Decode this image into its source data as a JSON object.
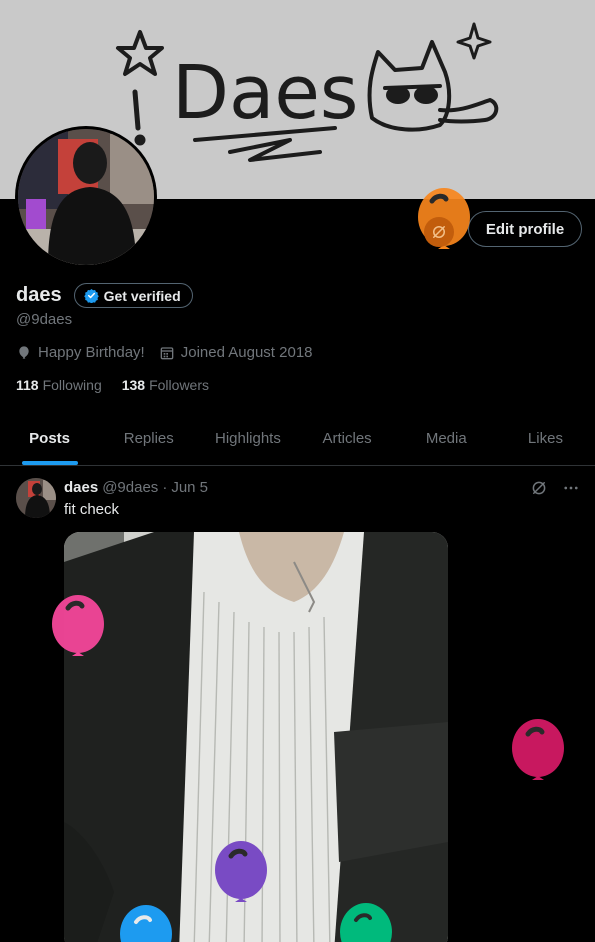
{
  "banner": {
    "sketch_text": "Daes",
    "paper_color": "#c9c9c9",
    "ink_color": "#1c1c1c"
  },
  "profile": {
    "display_name": "daes",
    "handle": "@9daes",
    "get_verified_label": "Get verified",
    "edit_profile_label": "Edit profile",
    "birthday_text": "Happy Birthday!",
    "joined_text": "Joined August 2018",
    "following_count": "118",
    "following_label": "Following",
    "followers_count": "138",
    "followers_label": "Followers"
  },
  "tabs": [
    {
      "label": "Posts",
      "active": true
    },
    {
      "label": "Replies",
      "active": false
    },
    {
      "label": "Highlights",
      "active": false
    },
    {
      "label": "Articles",
      "active": false
    },
    {
      "label": "Media",
      "active": false
    },
    {
      "label": "Likes",
      "active": false
    }
  ],
  "tweet": {
    "name": "daes",
    "handle": "@9daes",
    "separator": "·",
    "date": "Jun 5",
    "text": "fit check"
  },
  "balloons": [
    {
      "name": "orange-balloon",
      "color": "#f7861c"
    },
    {
      "name": "pink-balloon",
      "color": "#f4479a"
    },
    {
      "name": "magenta-balloon",
      "color": "#c8185f"
    },
    {
      "name": "purple-balloon",
      "color": "#794bc4"
    },
    {
      "name": "blue-balloon",
      "color": "#1d9bf0"
    },
    {
      "name": "green-balloon",
      "color": "#00ba7c"
    }
  ],
  "colors": {
    "accent": "#1d9bf0",
    "text_primary": "#e7e9ea",
    "text_secondary": "#71767b",
    "border": "#2f3336",
    "background": "#000000"
  },
  "icons": {
    "birthday": "balloon-icon",
    "joined": "calendar-icon",
    "verified": "verified-badge-icon",
    "grok": "grok-icon",
    "more": "more-dots-icon"
  }
}
